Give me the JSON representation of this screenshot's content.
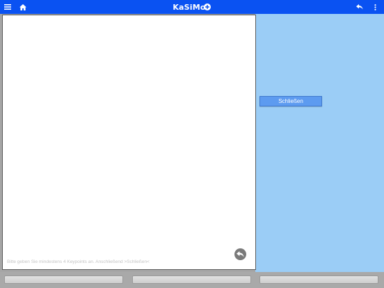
{
  "app": {
    "title": "KaSiMo"
  },
  "topbar": {
    "icons": [
      "menu-icon",
      "home-icon",
      "add-circle-icon",
      "undo-arrow-icon",
      "more-vertical-icon"
    ],
    "background_color": "#0a52f2"
  },
  "canvas": {
    "hint": "Bitte geben Sie mindestens 4 Keypoints an. Anschließend >Schließen<"
  },
  "side_panel": {
    "close_label": "Schließen",
    "background_color": "#9bcdf6"
  },
  "bottom_bar": {
    "buttons": [
      "",
      "",
      ""
    ]
  }
}
